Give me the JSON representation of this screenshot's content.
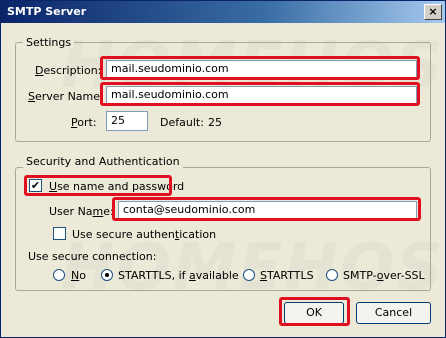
{
  "window": {
    "title": "SMTP Server",
    "close_glyph": "×"
  },
  "watermark": {
    "text": "HOMEHOST"
  },
  "settings": {
    "legend": "Settings",
    "description_label_pre": "",
    "description_label_u": "D",
    "description_label_post": "escription:",
    "description_value": "mail.seudominio.com",
    "server_label_pre": "",
    "server_label_u": "S",
    "server_label_post": "erver Name:",
    "server_value": "mail.seudominio.com",
    "port_label_pre": "",
    "port_label_u": "P",
    "port_label_post": "ort:",
    "port_value": "25",
    "default_label": "Default:",
    "default_value": "25"
  },
  "security": {
    "legend": "Security and Authentication",
    "use_name_checked": true,
    "use_name_label_pre": "",
    "use_name_label_u": "U",
    "use_name_label_post": "se name and password",
    "user_name_label_pre": "User Na",
    "user_name_label_u": "m",
    "user_name_label_post": "e:",
    "user_name_value": "conta@seudominio.com",
    "secure_auth_checked": false,
    "secure_auth_label_pre": "Use secure authen",
    "secure_auth_label_u": "t",
    "secure_auth_label_post": "ication",
    "connection_label": "Use secure connection:",
    "options": [
      {
        "pre": "",
        "u": "N",
        "post": "o",
        "selected": false
      },
      {
        "pre": "STARTTLS, if ",
        "u": "a",
        "post": "vailable",
        "selected": true
      },
      {
        "pre": "",
        "u": "S",
        "post": "TARTTLS",
        "selected": false
      },
      {
        "pre": "SMTP-",
        "u": "o",
        "post": "ver-SSL",
        "selected": false
      }
    ]
  },
  "buttons": {
    "ok": "OK",
    "cancel": "Cancel"
  },
  "colors": {
    "highlight": "#e01020",
    "titlebar": "#0a246a"
  }
}
